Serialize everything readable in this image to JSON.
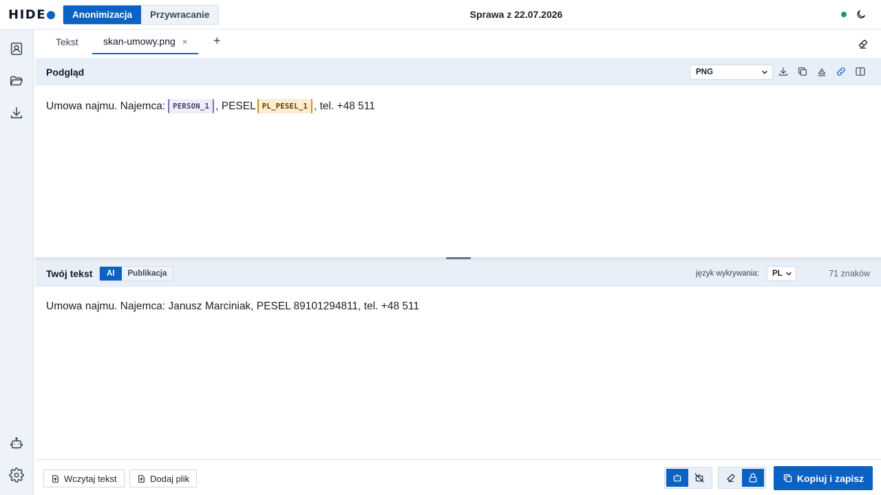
{
  "app": {
    "logo_text": "HIDE",
    "modes": [
      "Anonimizacja",
      "Przywracanie"
    ],
    "case_title": "Sprawa z 22.07.2026",
    "colors": {
      "accent": "#0a62c4",
      "status_ok": "#1d9a5b",
      "person_token": "#7d6bc4",
      "pesel_token": "#d48b1a"
    }
  },
  "sidebar": {
    "items": [
      {
        "icon": "contact-book-icon"
      },
      {
        "icon": "folder-open-icon"
      },
      {
        "icon": "download-icon"
      },
      {
        "icon": "robot-icon"
      },
      {
        "icon": "gear-icon"
      }
    ]
  },
  "tabs": {
    "items": [
      {
        "label": "Tekst"
      },
      {
        "label": "skan-umowy.png",
        "active": true,
        "close": "×"
      }
    ],
    "add": "+"
  },
  "preview": {
    "title": "Podgląd",
    "format": "PNG",
    "segments": {
      "t1": "Umowa najmu. Najemca:",
      "token1": "PERSON_1",
      "t2": ", PESEL",
      "token2": "PL_PESEL_1",
      "t3": ", tel. +48 511"
    }
  },
  "input": {
    "title": "Twój tekst",
    "modes": [
      "AI",
      "Publikacja"
    ],
    "lang_label": "język wykrywania:",
    "lang_value": "PL",
    "char_count": "71 znaków",
    "text": "Umowa najmu. Najemca: Janusz Marciniak, PESEL 89101294811, tel. +48 511"
  },
  "footer": {
    "load_text": "Wczytaj tekst",
    "add_file": "Dodaj plik",
    "primary": "Kopiuj i zapisz"
  }
}
